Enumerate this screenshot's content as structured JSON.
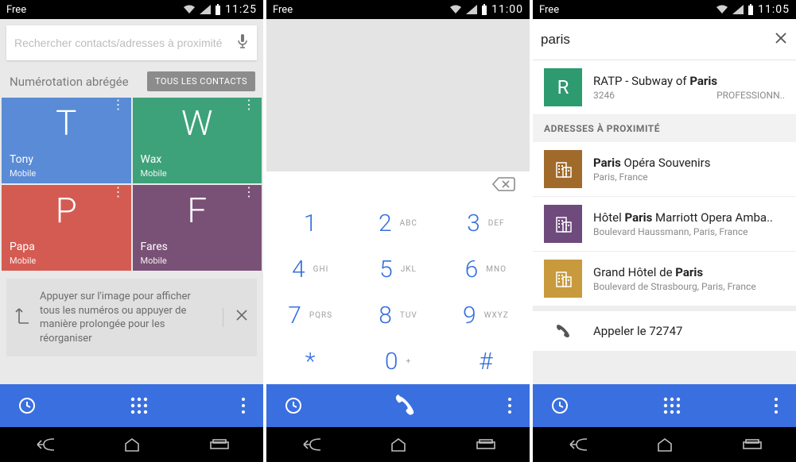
{
  "screen1": {
    "status": {
      "carrier": "Free",
      "time": "11:25"
    },
    "search_placeholder": "Rechercher contacts/adresses à proximité",
    "header_title": "Numérotation abrégée",
    "header_chip": "TOUS LES CONTACTS",
    "tiles": [
      {
        "initial": "T",
        "name": "Tony",
        "sub": "Mobile",
        "color": "blue"
      },
      {
        "initial": "W",
        "name": "Wax",
        "sub": "Mobile",
        "color": "green"
      },
      {
        "initial": "P",
        "name": "Papa",
        "sub": "Mobile",
        "color": "red"
      },
      {
        "initial": "F",
        "name": "Fares",
        "sub": "Mobile",
        "color": "purple"
      }
    ],
    "hint": "Appuyer sur l'image pour afficher tous les numéros ou appuyer de manière prolongée pour les réorganiser"
  },
  "screen2": {
    "status": {
      "carrier": "Free",
      "time": "11:00"
    },
    "keys": [
      {
        "num": "1",
        "let": ""
      },
      {
        "num": "2",
        "let": "ABC"
      },
      {
        "num": "3",
        "let": "DEF"
      },
      {
        "num": "4",
        "let": "GHI"
      },
      {
        "num": "5",
        "let": "JKL"
      },
      {
        "num": "6",
        "let": "MNO"
      },
      {
        "num": "7",
        "let": "PQRS"
      },
      {
        "num": "8",
        "let": "TUV"
      },
      {
        "num": "9",
        "let": "WXYZ"
      },
      {
        "num": "*",
        "let": ""
      },
      {
        "num": "0",
        "let": "+"
      },
      {
        "num": "#",
        "let": ""
      }
    ]
  },
  "screen3": {
    "status": {
      "carrier": "Free",
      "time": "11:05"
    },
    "search_value": "paris",
    "top_result": {
      "initial": "R",
      "title_pre": "RATP - Subway of ",
      "title_bold": "Paris",
      "title_post": "",
      "sub_left": "3246",
      "sub_right": "PROFESSIONN.."
    },
    "section": "ADRESSES À PROXIMITÉ",
    "places": [
      {
        "title_pre": "",
        "title_bold": "Paris",
        "title_post": " Opéra Souvenirs",
        "sub": "Paris, France",
        "avatar": "brown"
      },
      {
        "title_pre": "Hôtel ",
        "title_bold": "Paris",
        "title_post": " Marriott Opera Amba..",
        "sub": "Boulevard Haussmann, Paris, France",
        "avatar": "purple2"
      },
      {
        "title_pre": "Grand Hôtel de ",
        "title_bold": "Paris",
        "title_post": "",
        "sub": "Boulevard de Strasbourg, Paris, France",
        "avatar": "gold"
      }
    ],
    "call_label": "Appeler le 72747"
  }
}
